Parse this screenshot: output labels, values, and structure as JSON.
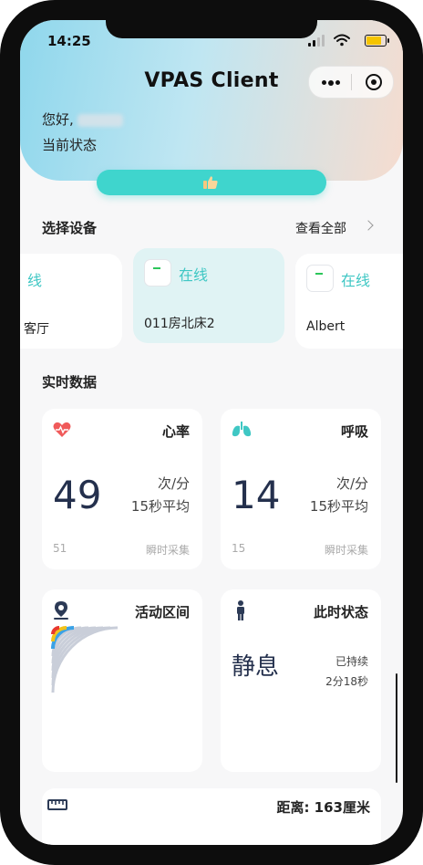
{
  "status_bar": {
    "time": "14:25"
  },
  "app": {
    "title": "VPAS Client"
  },
  "greeting": {
    "hello": "您好,",
    "current_state_label": "当前状态"
  },
  "devices_section": {
    "title": "选择设备",
    "view_all": "查看全部",
    "devices": [
      {
        "status": "线",
        "name": "客厅"
      },
      {
        "status": "在线",
        "name": "011房北床2"
      },
      {
        "status": "在线",
        "name": "Albert"
      }
    ]
  },
  "realtime_section": {
    "title": "实时数据"
  },
  "heart_rate": {
    "label": "心率",
    "value": "49",
    "unit": "次/分",
    "avg_label": "15秒平均",
    "instant_value": "51",
    "instant_label": "瞬时采集"
  },
  "breathing": {
    "label": "呼吸",
    "value": "14",
    "unit": "次/分",
    "avg_label": "15秒平均",
    "instant_value": "15",
    "instant_label": "瞬时采集"
  },
  "activity": {
    "label": "活动区间"
  },
  "current_state": {
    "label": "此时状态",
    "value": "静息",
    "duration_label": "已持续",
    "duration": "2分18秒"
  },
  "distance": {
    "label": "距离:  163厘米"
  },
  "colors": {
    "accent": "#3fd5cd",
    "online": "#3fc7c4",
    "heart": "#f05a5a",
    "lung": "#3fc7c4"
  },
  "icons": {
    "heart": "heart-icon",
    "lungs": "lungs-icon",
    "location": "location-pin-icon",
    "person": "person-icon",
    "ruler": "ruler-icon",
    "thumbs_up": "thumbs-up-icon"
  }
}
